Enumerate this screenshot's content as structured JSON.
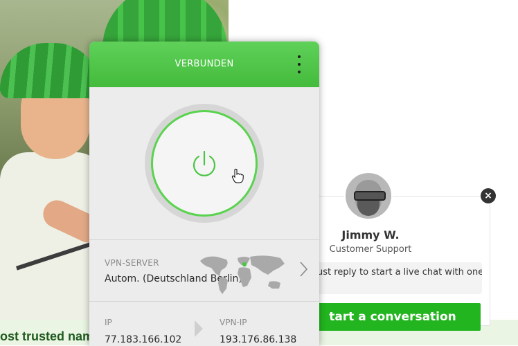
{
  "vpn": {
    "status": "VERBUNDEN",
    "server_label": "VPN-SERVER",
    "server_value": "Autom. (Deutschland Berlin)",
    "ip_label": "IP",
    "ip_value": "77.183.166.102",
    "vpn_ip_label": "VPN-IP",
    "vpn_ip_value": "193.176.86.138",
    "accent_color": "#4cc447",
    "icons": [
      "kebab-menu-icon",
      "power-icon",
      "world-map-icon",
      "chevron-right-icon",
      "arrow-right-icon"
    ]
  },
  "chat": {
    "agent_name": "Jimmy W.",
    "agent_role": "Customer Support",
    "message_preview": "ust reply to start a live chat with one",
    "start_button": "tart a conversation",
    "close_symbol": "×",
    "button_color": "#22b51f"
  },
  "page": {
    "slogan_fragment": "ost trusted nam"
  }
}
